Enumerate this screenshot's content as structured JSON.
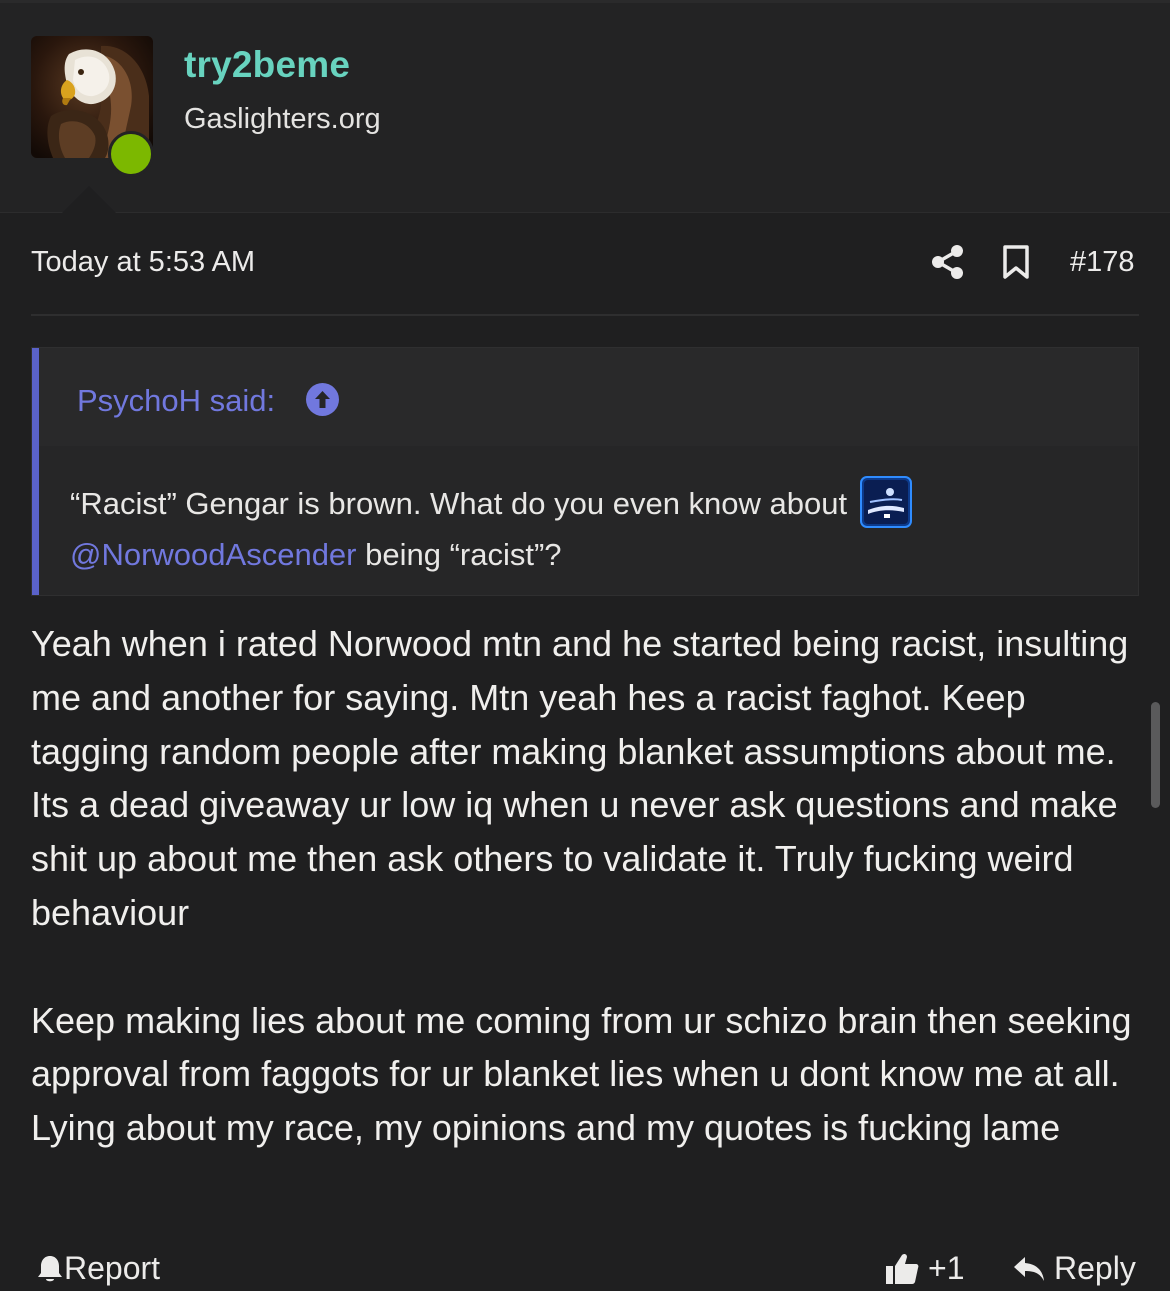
{
  "user": {
    "username": "try2beme",
    "title": "Gaslighters.org",
    "online": true,
    "avatar_icon": "eagle-avatar"
  },
  "post": {
    "date": "Today at 5:53 AM",
    "number": "#178",
    "quote": {
      "author": "PsychoH said:",
      "text_before": "“Racist” Gengar is brown. What do you even know about",
      "mention": "@NorwoodAscender",
      "text_after": "being “racist”?"
    },
    "body_paragraph_1": "Yeah when i rated Norwood mtn and he started being racist, insulting me and another for saying. Mtn yeah hes a racist faghot. Keep tagging random people after making blanket assumptions about me. Its a dead giveaway ur low iq when u never ask questions and make shit up about me then ask others to validate it. Truly fucking weird behaviour",
    "body_paragraph_2": "Keep making lies about me coming from ur schizo brain then seeking approval from faggots for ur blanket lies when u dont know me at all. Lying about my race, my opinions and my quotes is fucking lame"
  },
  "actions": {
    "report": "Report",
    "like": "+1",
    "reply": "Reply"
  },
  "colors": {
    "background": "#1f1f20",
    "username": "#68d3bf",
    "accent": "#7178de",
    "online": "#7cb800"
  }
}
